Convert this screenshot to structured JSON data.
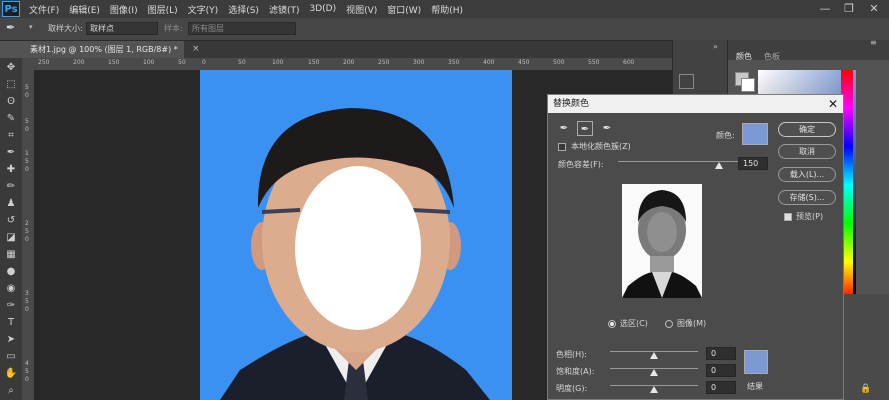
{
  "menubar": {
    "logo": "Ps",
    "items": [
      "文件(F)",
      "编辑(E)",
      "图像(I)",
      "图层(L)",
      "文字(Y)",
      "选择(S)",
      "滤镜(T)",
      "3D(D)",
      "视图(V)",
      "窗口(W)",
      "帮助(H)"
    ],
    "minimize": "—",
    "restore": "❐",
    "close": "✕"
  },
  "options": {
    "sample_size_label": "取样大小:",
    "sample_size_value": "取样点",
    "sample_label": "样本:",
    "sample_value": "所有图层"
  },
  "document": {
    "tab_title": "素材1.jpg @ 100% (图层 1, RGB/8#) *",
    "close": "×"
  },
  "ruler": {
    "h_marks": [
      "250",
      "200",
      "150",
      "100",
      "50",
      "0",
      "50",
      "100",
      "150",
      "200",
      "250",
      "300",
      "350",
      "400",
      "450",
      "500",
      "550",
      "600"
    ],
    "v_marks": [
      "5",
      "0",
      "5",
      "0",
      "1",
      "5",
      "0",
      "2",
      "5",
      "0",
      "3",
      "5",
      "0",
      "4",
      "5",
      "0"
    ]
  },
  "right_panel": {
    "tab_color": "颜色",
    "tab_swatches": "色板"
  },
  "dialog": {
    "title": "替换颜色",
    "close": "✕",
    "localized_label": "本地化颜色簇(Z)",
    "color_label": "颜色:",
    "tolerance_label": "颜色容差(F):",
    "tolerance_value": "150",
    "tolerance_fraction": 0.42,
    "buttons": {
      "ok": "确定",
      "cancel": "取消",
      "load": "载入(L)...",
      "save": "存储(S)..."
    },
    "preview_label": "预览(P)",
    "preview_checked": true,
    "localized_checked": false,
    "view_selection": "选区(C)",
    "view_image": "图像(M)",
    "hue_label": "色相(H):",
    "hue_value": "0",
    "saturation_label": "饱和度(A):",
    "saturation_value": "0",
    "lightness_label": "明度(G):",
    "lightness_value": "0",
    "result_label": "结果",
    "color_swatch": "#7c99d6",
    "result_swatch": "#7c99d6"
  },
  "colors": {
    "photo_background": "#3b91f2",
    "accent": "#31a8ff"
  }
}
